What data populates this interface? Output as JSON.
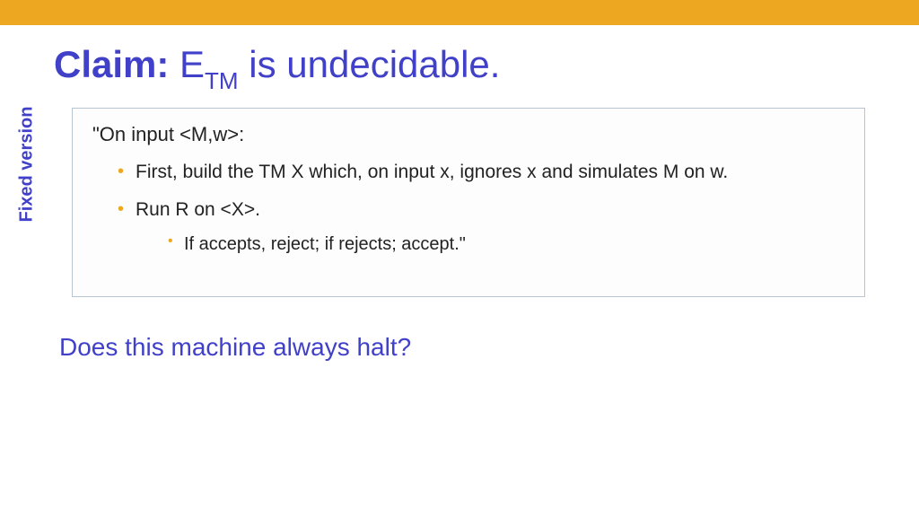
{
  "colors": {
    "accent": "#eda721",
    "primary": "#4040c9"
  },
  "title": {
    "claim": "Claim:",
    "exp_main": "E",
    "exp_sub": "TM",
    "rest": " is undecidable."
  },
  "sidebar_label": "Fixed version",
  "box": {
    "input_line": "\"On input <M,w>:",
    "bullets": [
      "First, build the TM X which, on input x, ignores x and simulates M on w.",
      "Run R on <X>."
    ],
    "nested": [
      "If accepts, reject; if rejects; accept.\""
    ]
  },
  "question": "Does this machine always halt?"
}
